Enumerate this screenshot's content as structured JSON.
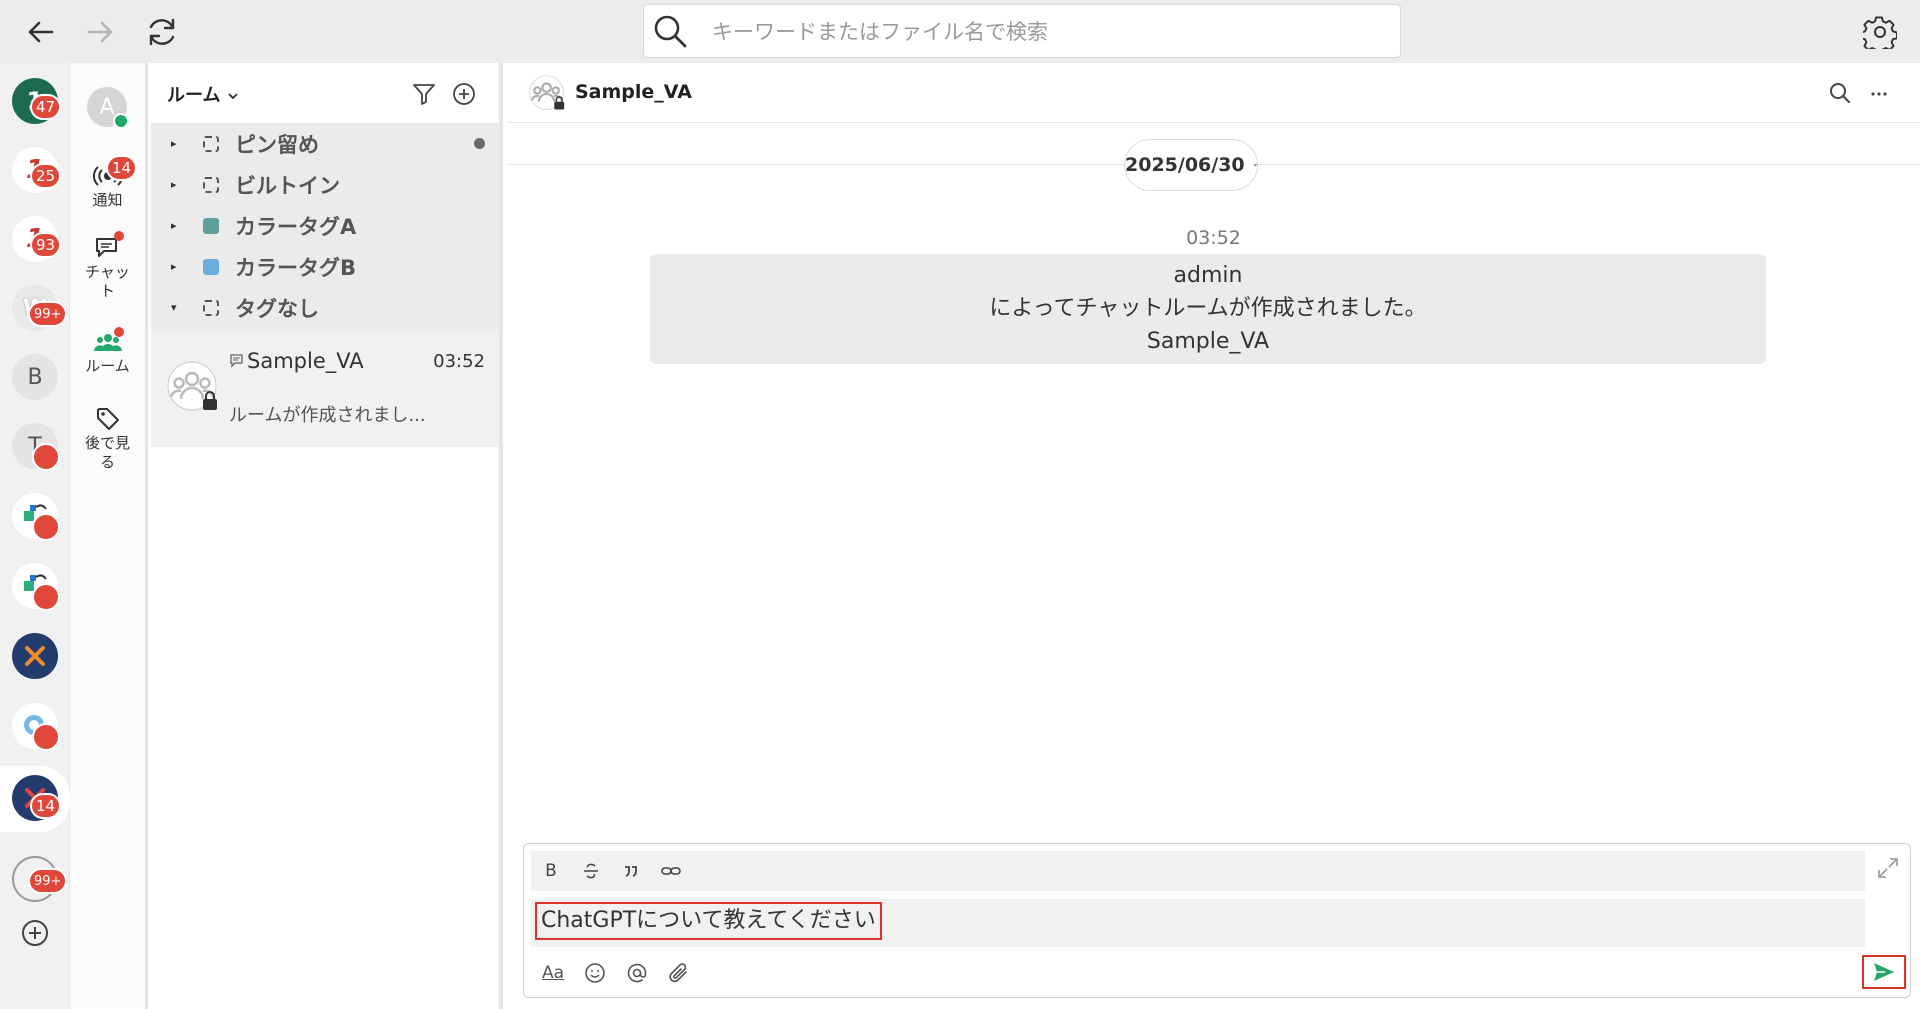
{
  "search": {
    "placeholder": "キーワードまたはファイル名で検索"
  },
  "accounts": [
    {
      "initial": "",
      "badge": "47",
      "color": "#1d6b4e"
    },
    {
      "initial": "",
      "badge": "25",
      "color": "#c53a30"
    },
    {
      "initial": "",
      "badge": "93",
      "color": "#c53a30"
    },
    {
      "initial": "W",
      "badge": "99+",
      "color": "#cfcfcf"
    },
    {
      "initial": "B",
      "badge": "",
      "color": "#e4e4e4"
    },
    {
      "initial": "T",
      "badge": "",
      "color": "#e4e4e4"
    },
    {
      "initial": "",
      "badge": "",
      "color": "#2bb07d"
    },
    {
      "initial": "",
      "badge": "",
      "color": "#2bb07d"
    },
    {
      "initial": "",
      "badge": "",
      "color": "#243b6e"
    },
    {
      "initial": "",
      "badge": "",
      "color": "#74b8e8"
    },
    {
      "initial": "",
      "badge": "14",
      "color": "#243b6e"
    },
    {
      "initial": "",
      "badge": "99+",
      "color": "#f1f1f1"
    }
  ],
  "user": {
    "initial": "A"
  },
  "nav": {
    "notify_label": "通知",
    "notify_badge": "14",
    "chat_label_1": "チャッ",
    "chat_label_2": "ト",
    "room_label": "ルーム",
    "later_label_1": "後で見",
    "later_label_2": "る"
  },
  "room_panel": {
    "title": "ルーム",
    "tags": [
      {
        "label": "ピン留め",
        "caret": "▸",
        "style": "dashed",
        "color": ""
      },
      {
        "label": "ビルトイン",
        "caret": "▸",
        "style": "dashed",
        "color": ""
      },
      {
        "label": "カラータグA",
        "caret": "▸",
        "style": "solid",
        "color": "#5fa09a"
      },
      {
        "label": "カラータグB",
        "caret": "▸",
        "style": "solid",
        "color": "#6aaee0"
      },
      {
        "label": "タグなし",
        "caret": "▾",
        "style": "dashed",
        "color": ""
      }
    ],
    "room": {
      "name": "Sample_VA",
      "time": "03:52",
      "preview": "ルームが作成されまし..."
    }
  },
  "chat": {
    "title": "Sample_VA",
    "date": "2025/06/30",
    "message_time": "03:52",
    "system_message": {
      "line1": "admin",
      "line2": "によってチャットルームが作成されました。",
      "line3": "Sample_VA"
    }
  },
  "composer": {
    "bold": "B",
    "aa": "Aa",
    "input_value": "ChatGPTについて教えてください"
  },
  "colors": {
    "accent": "#27a76b",
    "badge": "#e0473b",
    "highlight": "#e0312a"
  }
}
